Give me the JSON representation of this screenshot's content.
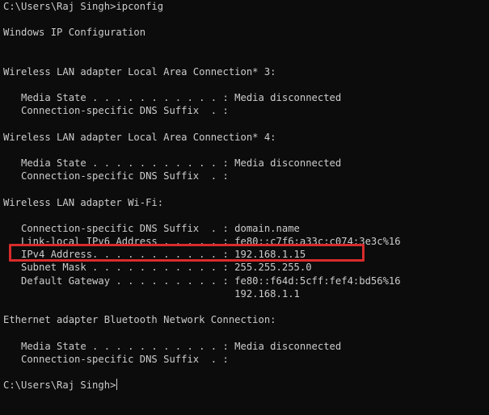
{
  "terminal": {
    "lines": [
      "C:\\Users\\Raj Singh>ipconfig",
      "",
      "Windows IP Configuration",
      "",
      "",
      "Wireless LAN adapter Local Area Connection* 3:",
      "",
      "   Media State . . . . . . . . . . . : Media disconnected",
      "   Connection-specific DNS Suffix  . :",
      "",
      "Wireless LAN adapter Local Area Connection* 4:",
      "",
      "   Media State . . . . . . . . . . . : Media disconnected",
      "   Connection-specific DNS Suffix  . :",
      "",
      "Wireless LAN adapter Wi-Fi:",
      "",
      "   Connection-specific DNS Suffix  . : domain.name",
      "   Link-local IPv6 Address . . . . . : fe80::c7f6:a33c:c074:3e3c%16",
      "   IPv4 Address. . . . . . . . . . . : 192.168.1.15",
      "   Subnet Mask . . . . . . . . . . . : 255.255.255.0",
      "   Default Gateway . . . . . . . . . : fe80::f64d:5cff:fef4:bd56%16",
      "                                       192.168.1.1",
      "",
      "Ethernet adapter Bluetooth Network Connection:",
      "",
      "   Media State . . . . . . . . . . . : Media disconnected",
      "   Connection-specific DNS Suffix  . :",
      "",
      "C:\\Users\\Raj Singh>"
    ]
  },
  "colors": {
    "background": "#0c0c0c",
    "text": "#cccccc",
    "highlight_border": "#d92b2b"
  }
}
